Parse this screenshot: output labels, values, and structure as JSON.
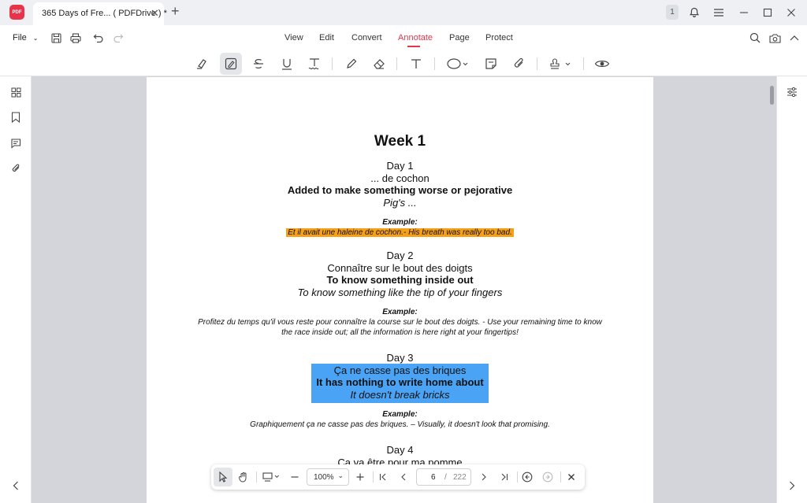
{
  "titlebar": {
    "logo_text": "PDF",
    "tab_title": "365 Days of Fre... ( PDFDrive ) *",
    "badge": "1"
  },
  "menubar": {
    "file_label": "File",
    "tabs": [
      "View",
      "Edit",
      "Convert",
      "Annotate",
      "Page",
      "Protect"
    ],
    "active_tab": "Annotate"
  },
  "colors": {
    "accent": "#e8344a",
    "highlight_orange": "#f6a01a",
    "highlight_blue": "#4aa3f4"
  },
  "document": {
    "week_title": "Week 1",
    "days": [
      {
        "day": "Day 1",
        "french": "... de cochon",
        "english_bold": "Added to make something worse or pejorative",
        "english_italic": "Pig's ...",
        "example_label": "Example:",
        "example_line1": "Et il avait une haleine de cochon.- His breath was really too bad.",
        "example_line2": ""
      },
      {
        "day": "Day 2",
        "french": "Connaître sur le bout des doigts",
        "english_bold": "To know something inside out",
        "english_italic": "To know something like the tip of your fingers",
        "example_label": "Example:",
        "example_line1": "Profitez du temps qu'il vous reste pour connaître la course sur le bout des doigts. - Use your remaining time to know",
        "example_line2": "the race inside out; all the information is here right at your fingertips!"
      },
      {
        "day": "Day 3",
        "french": "Ça ne casse pas des briques",
        "english_bold": "It has nothing to write home about",
        "english_italic": "It doesn't break bricks",
        "example_label": "Example:",
        "example_line1": "Graphiquement ça ne casse pas des briques. – Visually, it doesn't look that promising.",
        "example_line2": ""
      },
      {
        "day": "Day 4",
        "french": "Ça va être pour ma pomme"
      }
    ]
  },
  "bottombar": {
    "zoom": "100%",
    "current_page": "6",
    "page_separator": "/",
    "total_pages": "222"
  }
}
